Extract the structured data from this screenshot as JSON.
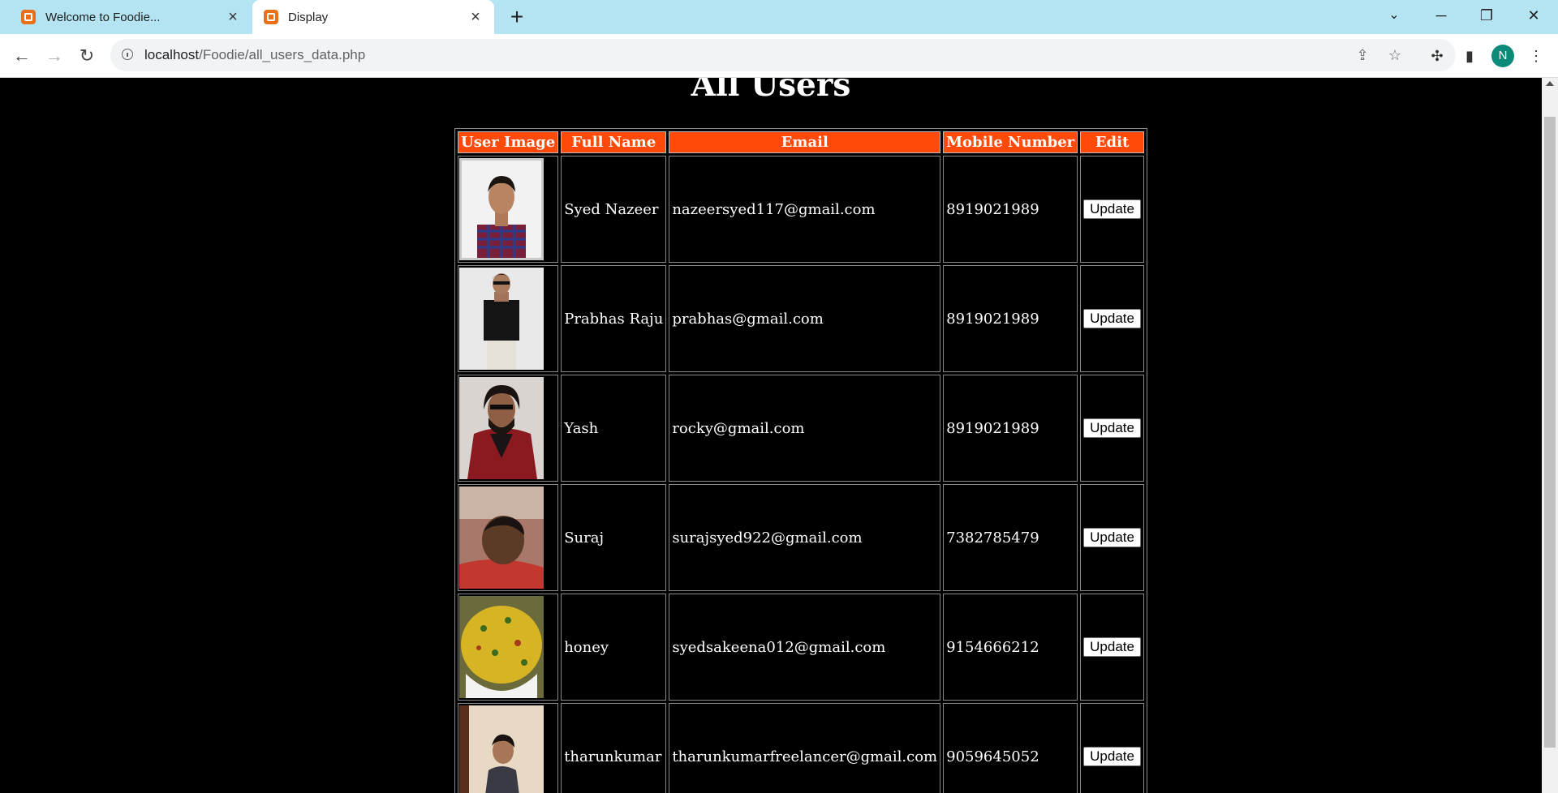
{
  "browser": {
    "tabs": [
      {
        "title": "Welcome to Foodie..."
      },
      {
        "title": "Display"
      }
    ],
    "url_host": "localhost",
    "url_path": "/Foodie/all_users_data.php",
    "profile_initial": "N"
  },
  "page": {
    "title": "All Users",
    "columns": [
      "User Image",
      "Full Name",
      "Email",
      "Mobile Number",
      "Edit"
    ],
    "update_label": "Update",
    "users": [
      {
        "name": "Syed Nazeer",
        "email": "nazeersyed117@gmail.com",
        "mobile": "8919021989"
      },
      {
        "name": "Prabhas Raju",
        "email": "prabhas@gmail.com",
        "mobile": "8919021989"
      },
      {
        "name": "Yash",
        "email": "rocky@gmail.com",
        "mobile": "8919021989"
      },
      {
        "name": "Suraj",
        "email": "surajsyed922@gmail.com",
        "mobile": "7382785479"
      },
      {
        "name": "honey",
        "email": "syedsakeena012@gmail.com",
        "mobile": "9154666212"
      },
      {
        "name": "tharunkumar",
        "email": "tharunkumarfreelancer@gmail.com",
        "mobile": "9059645052"
      }
    ]
  }
}
